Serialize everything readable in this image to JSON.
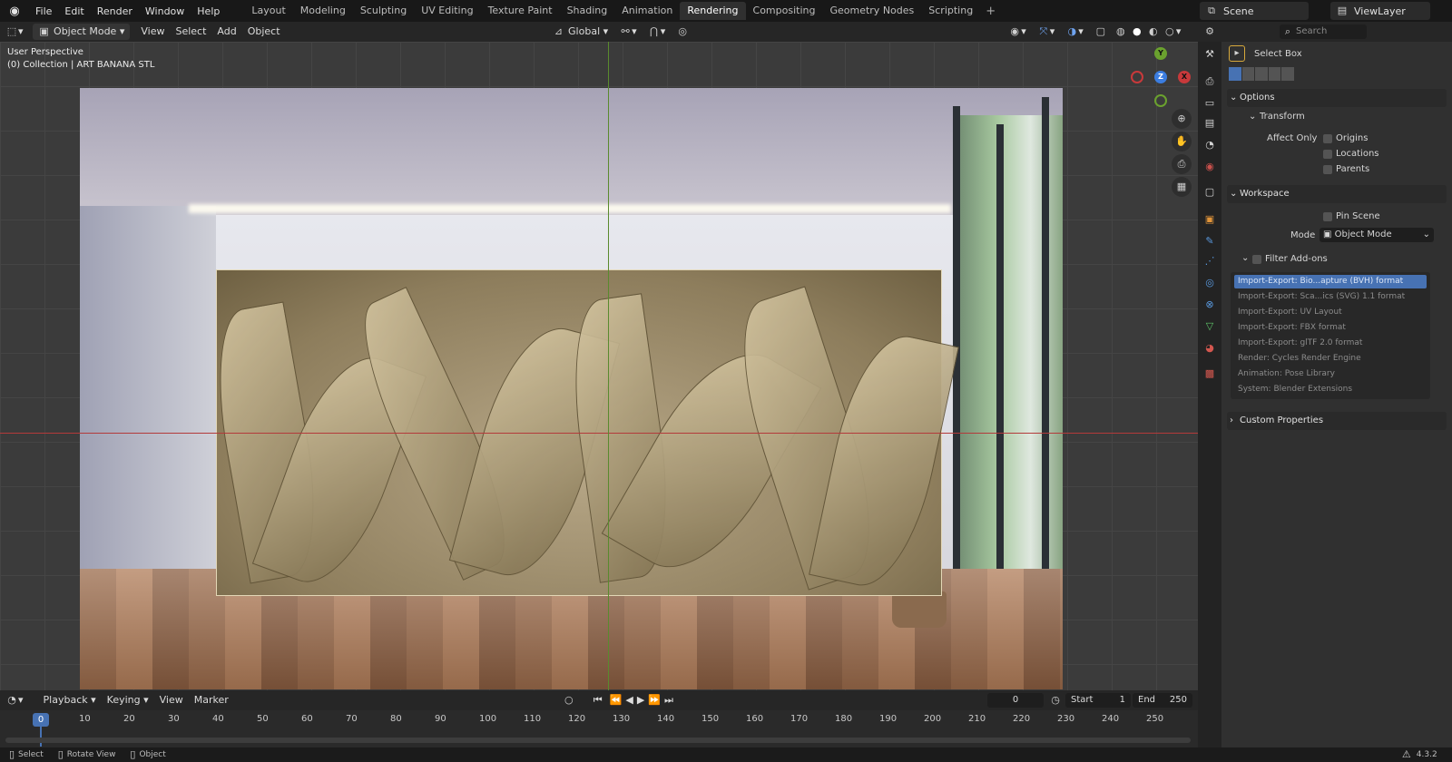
{
  "topbar": {
    "menus": [
      "File",
      "Edit",
      "Render",
      "Window",
      "Help"
    ],
    "workspaces": [
      "Layout",
      "Modeling",
      "Sculpting",
      "UV Editing",
      "Texture Paint",
      "Shading",
      "Animation",
      "Rendering",
      "Compositing",
      "Geometry Nodes",
      "Scripting"
    ],
    "active_workspace": "Rendering",
    "add_tab": "+",
    "scene": "Scene",
    "view_layer": "ViewLayer"
  },
  "viewport_header": {
    "mode": "Object Mode",
    "menus": [
      "View",
      "Select",
      "Add",
      "Object"
    ],
    "transform_orientation": "Global"
  },
  "viewport": {
    "perspective": "User Perspective",
    "collection": "(0) Collection | ART BANANA STL",
    "gizmo": {
      "x": "X",
      "y": "Y",
      "z": "Z"
    },
    "colors": {
      "x_axis": "#c8393b",
      "y_axis": "#6aa12e",
      "z_axis": "#3b7de0"
    }
  },
  "properties": {
    "search_placeholder": "Search",
    "tool_name": "Select Box",
    "options_label": "Options",
    "transform_label": "Transform",
    "affect_only_label": "Affect Only",
    "affect_only": [
      "Origins",
      "Locations",
      "Parents"
    ],
    "workspace_label": "Workspace",
    "pin_scene": "Pin Scene",
    "mode_label": "Mode",
    "mode_value": "Object Mode",
    "filter_addons": "Filter Add-ons",
    "addons": [
      "Import-Export: Bio...apture (BVH) format",
      "Import-Export: Sca...ics (SVG) 1.1 format",
      "Import-Export: UV Layout",
      "Import-Export: FBX format",
      "Import-Export: glTF 2.0 format",
      "Render: Cycles Render Engine",
      "Animation: Pose Library",
      "System: Blender Extensions"
    ],
    "custom_properties": "Custom Properties"
  },
  "timeline": {
    "menus": [
      "Playback",
      "Keying",
      "View",
      "Marker"
    ],
    "current_frame": "0",
    "start_label": "Start",
    "start": "1",
    "end_label": "End",
    "end": "250",
    "ticks": [
      "10",
      "20",
      "30",
      "40",
      "50",
      "60",
      "70",
      "80",
      "90",
      "100",
      "110",
      "120",
      "130",
      "140",
      "150",
      "160",
      "170",
      "180",
      "190",
      "200",
      "210",
      "220",
      "230",
      "240",
      "250"
    ],
    "playhead": "0"
  },
  "statusbar": {
    "select": "Select",
    "rotate": "Rotate View",
    "object": "Object",
    "version": "4.3.2"
  }
}
